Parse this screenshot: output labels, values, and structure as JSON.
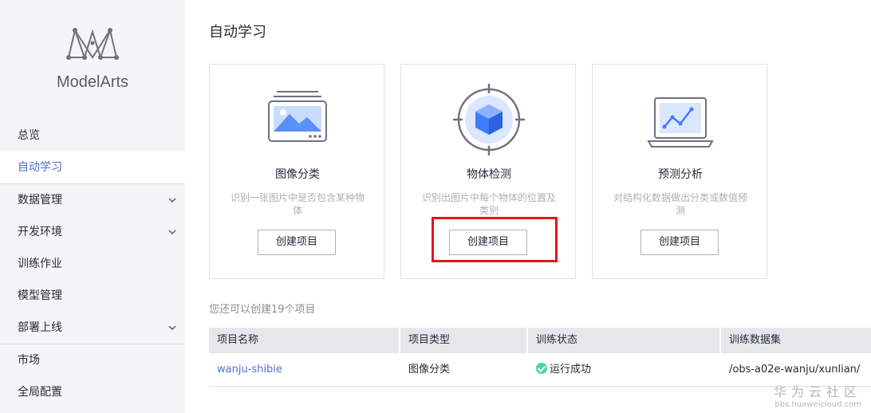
{
  "sidebar": {
    "brand": "ModelArts",
    "items": [
      {
        "label": "总览",
        "icon": ""
      },
      {
        "label": "自动学习",
        "icon": "",
        "active": true
      },
      {
        "label": "数据管理",
        "icon": "chevron-down-icon"
      },
      {
        "label": "开发环境",
        "icon": "chevron-down-icon"
      },
      {
        "label": "训练作业",
        "icon": ""
      },
      {
        "label": "模型管理",
        "icon": ""
      },
      {
        "label": "部署上线",
        "icon": "chevron-down-icon"
      },
      {
        "label": "市场",
        "icon": ""
      },
      {
        "label": "全局配置",
        "icon": ""
      }
    ]
  },
  "main": {
    "title": "自动学习",
    "cards": [
      {
        "title": "图像分类",
        "desc": "识别一张图片中是否包含某种物体",
        "button": "创建项目",
        "icon": "image-classification-icon"
      },
      {
        "title": "物体检测",
        "desc": "识别出图片中每个物体的位置及类别",
        "button": "创建项目",
        "icon": "object-detection-icon"
      },
      {
        "title": "预测分析",
        "desc": "对结构化数据做出分类或数值预测",
        "button": "创建项目",
        "icon": "predictive-analysis-icon"
      }
    ],
    "quota_text": "您还可以创建19个项目",
    "table": {
      "headers": [
        "项目名称",
        "项目类型",
        "训练状态",
        "训练数据集"
      ],
      "rows": [
        {
          "name": "wanju-shibie",
          "type": "图像分类",
          "status": "运行成功",
          "dataset": "/obs-a02e-wanju/xunlian/"
        }
      ]
    }
  },
  "watermark": {
    "line1": "华为云社区",
    "line2": "bbs.huaweicloud.com"
  },
  "colors": {
    "accent": "#526ecc",
    "highlight": "#e0161b",
    "success": "#50d4ab"
  }
}
